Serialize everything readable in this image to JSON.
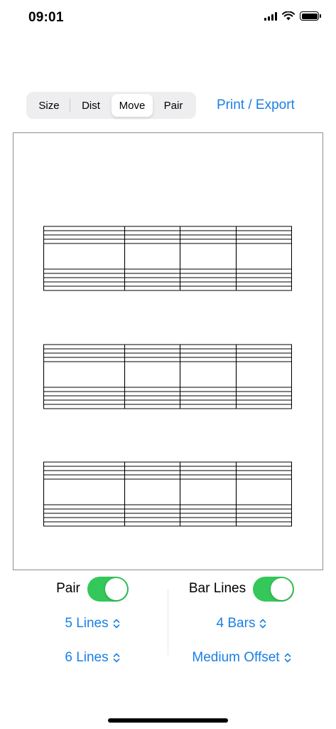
{
  "status_bar": {
    "time": "09:01"
  },
  "segmented": {
    "items": [
      {
        "label": "Size",
        "selected": false
      },
      {
        "label": "Dist",
        "selected": false
      },
      {
        "label": "Move",
        "selected": true
      },
      {
        "label": "Pair",
        "selected": false
      }
    ]
  },
  "header": {
    "print_label": "Print / Export"
  },
  "preview": {
    "staff_count": 3,
    "columns": 4,
    "line_color": "#000000"
  },
  "controls": {
    "left": {
      "toggle_label": "Pair",
      "toggle_on": true,
      "picker1": "5 Lines",
      "picker2": "6 Lines"
    },
    "right": {
      "toggle_label": "Bar Lines",
      "toggle_on": true,
      "picker1": "4 Bars",
      "picker2": "Medium Offset"
    }
  },
  "colors": {
    "accent": "#1a7fe6",
    "toggle_on": "#34c759",
    "segment_bg": "#eeeef0"
  }
}
